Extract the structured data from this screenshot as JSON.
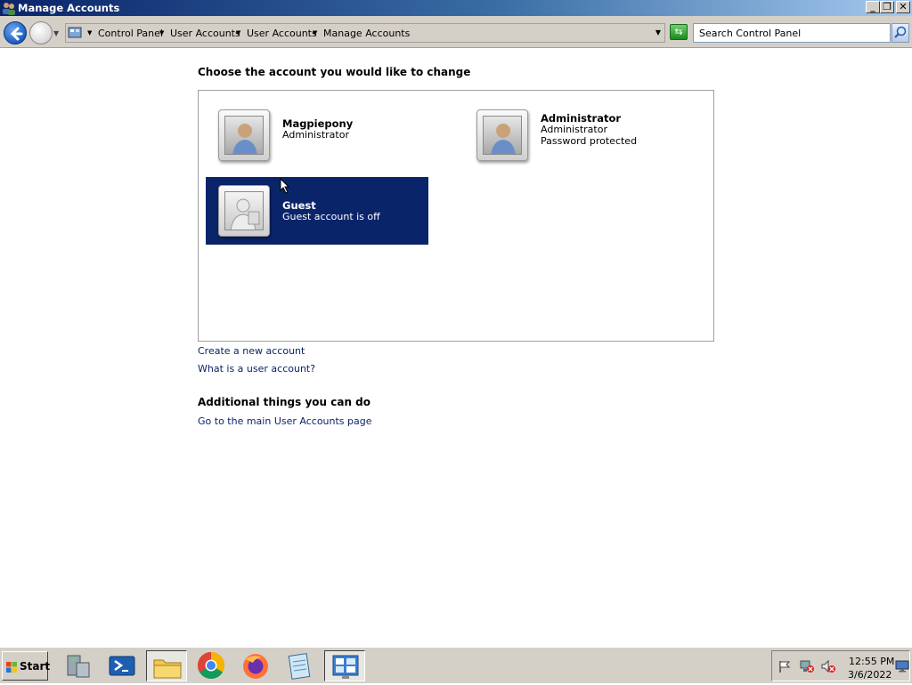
{
  "window": {
    "title": "Manage Accounts"
  },
  "address": {
    "breadcrumbs": [
      "Control Panel",
      "User Accounts",
      "User Accounts",
      "Manage Accounts"
    ],
    "search_placeholder": "Search Control Panel"
  },
  "main": {
    "heading": "Choose the account you would like to change",
    "accounts": [
      {
        "name": "Magpiepony",
        "lines": [
          "Administrator"
        ],
        "selected": false,
        "icon": "user-picture-icon"
      },
      {
        "name": "Administrator",
        "lines": [
          "Administrator",
          "Password protected"
        ],
        "selected": false,
        "icon": "user-picture-icon"
      },
      {
        "name": "Guest",
        "lines": [
          "Guest account is off"
        ],
        "selected": true,
        "icon": "guest-picture-icon"
      }
    ],
    "links": {
      "create": "Create a new account",
      "what_is": "What is a user account?"
    },
    "additional_heading": "Additional things you can do",
    "additional_links": [
      "Go to the main User Accounts page"
    ]
  },
  "taskbar": {
    "start_label": "Start",
    "items": [
      "server-manager-icon",
      "powershell-icon",
      "file-explorer-icon",
      "chrome-icon",
      "firefox-icon",
      "notepad-icon",
      "control-panel-icon"
    ],
    "active_item": "control-panel-icon",
    "clock": {
      "time": "12:55 PM",
      "date": "3/6/2022"
    }
  },
  "colors": {
    "selection": "#0a246a",
    "link": "#0a246a",
    "chrome": "#d4d0c8"
  }
}
